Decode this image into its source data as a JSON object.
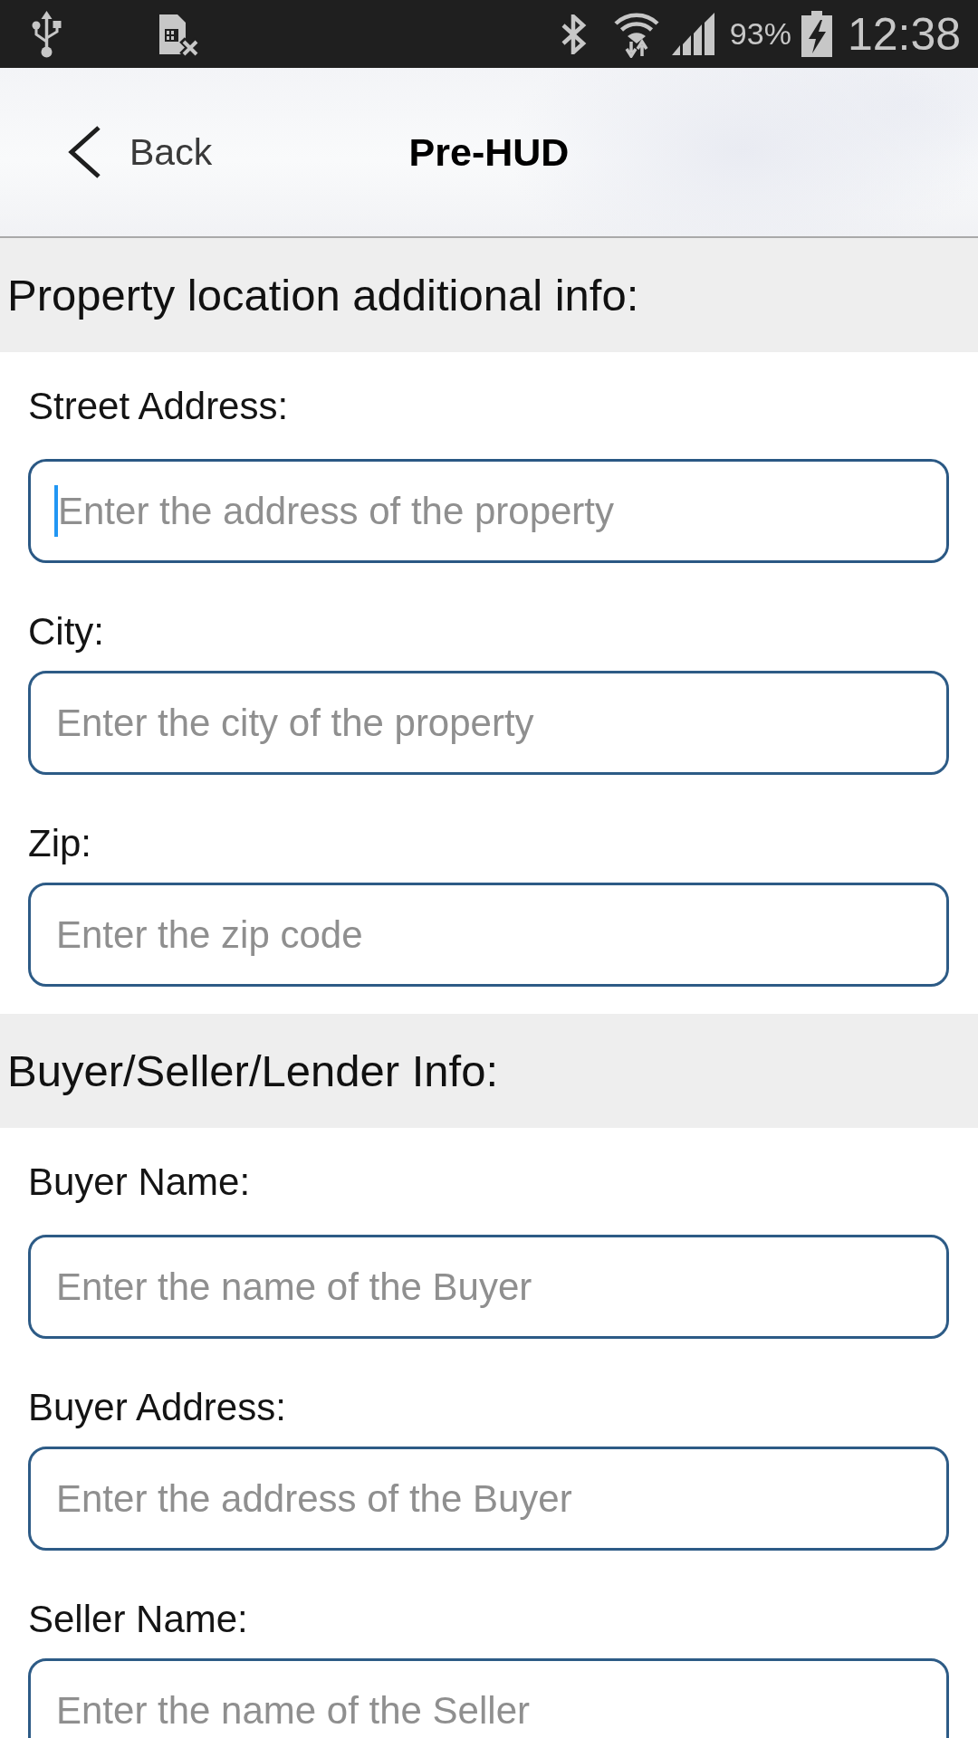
{
  "status_bar": {
    "battery": "93%",
    "time": "12:38"
  },
  "header": {
    "back_label": "Back",
    "title": "Pre-HUD"
  },
  "sections": [
    {
      "heading": "Property location additional info:",
      "fields": [
        {
          "label": "Street Address:",
          "placeholder": "Enter the address of the property",
          "focused": true
        },
        {
          "label": "City:",
          "placeholder": "Enter the city of the property",
          "focused": false
        },
        {
          "label": "Zip:",
          "placeholder": "Enter the zip code",
          "focused": false
        }
      ]
    },
    {
      "heading": "Buyer/Seller/Lender Info:",
      "fields": [
        {
          "label": "Buyer Name:",
          "placeholder": "Enter the name of the Buyer",
          "focused": false
        },
        {
          "label": "Buyer Address:",
          "placeholder": "Enter the address of the Buyer",
          "focused": false
        },
        {
          "label": "Seller Name:",
          "placeholder": "Enter the name of the Seller",
          "focused": false
        }
      ]
    }
  ]
}
